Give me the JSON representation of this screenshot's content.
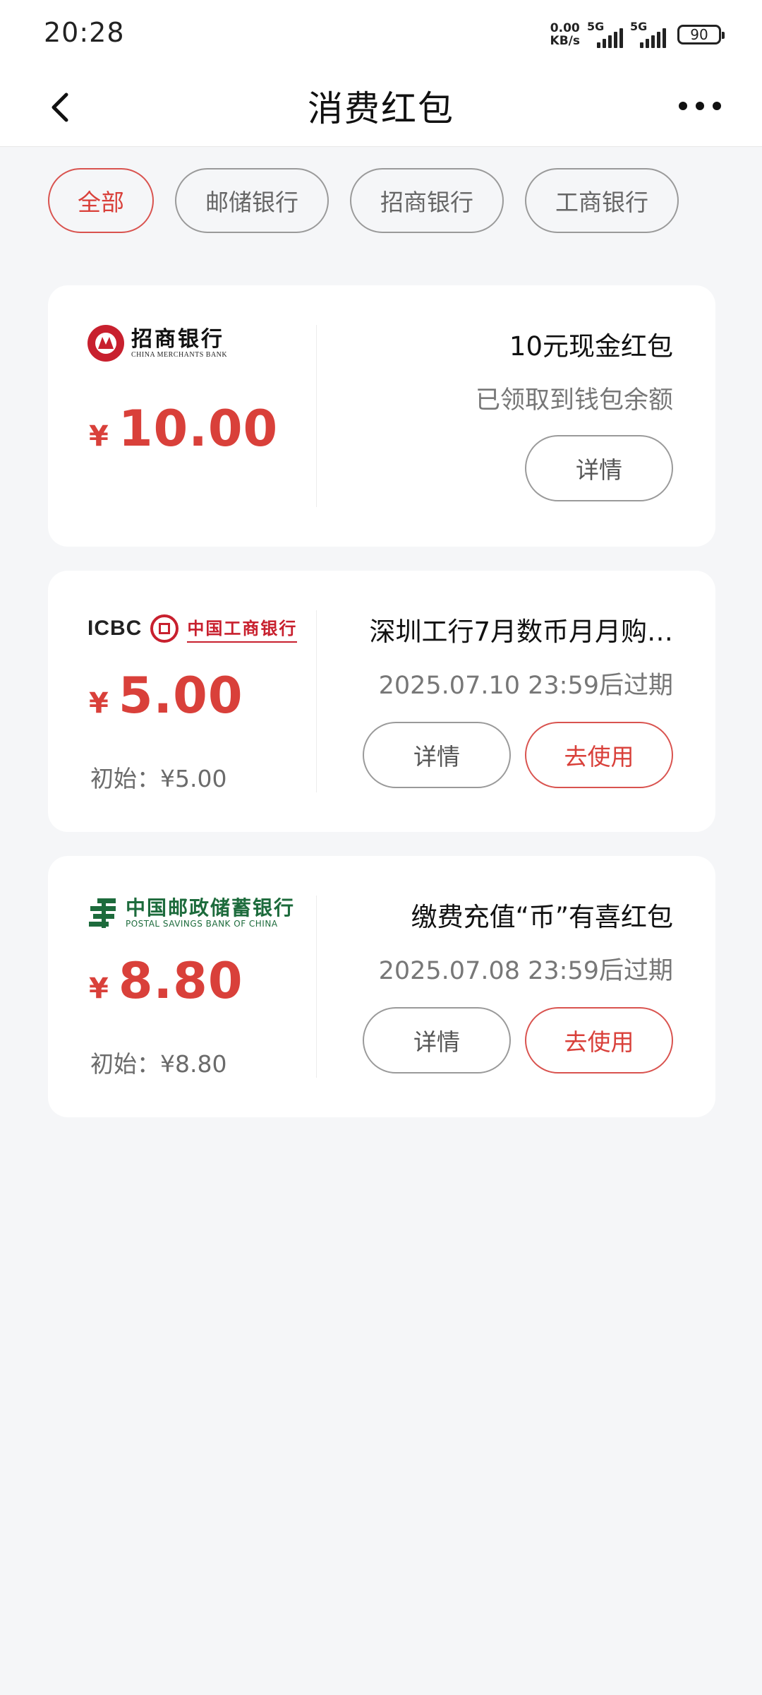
{
  "status_bar": {
    "time": "20:28",
    "net_speed_value": "0.00",
    "net_speed_unit": "KB/s",
    "signal1_label": "5G",
    "signal2_label": "5G",
    "battery": "90"
  },
  "header": {
    "title": "消费红包",
    "back_icon": "chevron-left-icon",
    "more_icon": "more-horizontal-icon"
  },
  "filters": [
    {
      "label": "全部",
      "active": true
    },
    {
      "label": "邮储银行",
      "active": false
    },
    {
      "label": "招商银行",
      "active": false
    },
    {
      "label": "工商银行",
      "active": false
    }
  ],
  "colors": {
    "accent": "#d9403a",
    "background": "#f5f6f8",
    "card": "#ffffff"
  },
  "cards": [
    {
      "bank_logo_cn": "招商银行",
      "bank_logo_en": "CHINA MERCHANTS BANK",
      "currency": "¥",
      "amount": "10.00",
      "title": "10元现金红包",
      "subtitle": "已领取到钱包余额",
      "detail_label": "详情"
    },
    {
      "bank_logo_en": "ICBC",
      "bank_logo_cn": "中国工商银行",
      "currency": "¥",
      "amount": "5.00",
      "initial": "初始：¥5.00",
      "title": "深圳工行7月数币月月购…",
      "subtitle": "2025.07.10 23:59后过期",
      "detail_label": "详情",
      "use_label": "去使用"
    },
    {
      "bank_logo_cn": "中国邮政储蓄银行",
      "bank_logo_en": "POSTAL SAVINGS BANK OF CHINA",
      "currency": "¥",
      "amount": "8.80",
      "initial": "初始：¥8.80",
      "title": "缴费充值“币”有喜红包",
      "subtitle": "2025.07.08 23:59后过期",
      "detail_label": "详情",
      "use_label": "去使用"
    }
  ]
}
